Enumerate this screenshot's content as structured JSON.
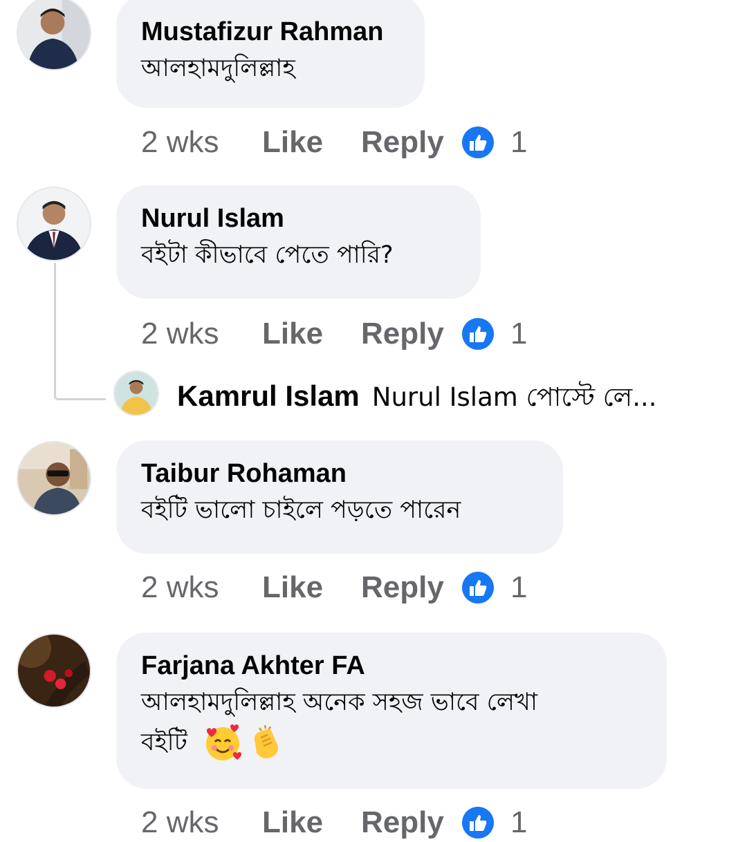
{
  "comments": [
    {
      "author": "Mustafizur Rahman",
      "text": "আলহামদুলিল্লাহ",
      "time": "2 wks",
      "like_label": "Like",
      "reply_label": "Reply",
      "reaction_count": "1"
    },
    {
      "author": "Nurul Islam",
      "text": "বইটা কীভাবে পেতে পারি?",
      "time": "2 wks",
      "like_label": "Like",
      "reply_label": "Reply",
      "reaction_count": "1",
      "reply_preview": {
        "author": "Kamrul Islam",
        "text": "Nurul Islam পোস্টে লে..."
      }
    },
    {
      "author": "Taibur Rohaman",
      "text": "বইটি ভালো চাইলে পড়তে পারেন",
      "time": "2 wks",
      "like_label": "Like",
      "reply_label": "Reply",
      "reaction_count": "1"
    },
    {
      "author": "Farjana Akhter FA",
      "text_line1": "আলহামদুলিল্লাহ অনেক সহজ ভাবে লেখা",
      "text_line2": "বইটি",
      "emojis": [
        "smiling-face-with-hearts",
        "clapping-hands"
      ],
      "time": "2 wks",
      "like_label": "Like",
      "reply_label": "Reply",
      "reaction_count": "1"
    }
  ],
  "colors": {
    "bubble": "#f0f2f5",
    "meta_text": "#65676b",
    "like_blue": "#1877f2",
    "name_text": "#050505"
  }
}
